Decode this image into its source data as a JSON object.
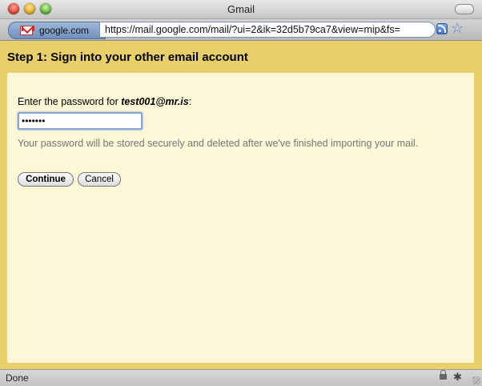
{
  "window": {
    "title": "Gmail"
  },
  "addressbar": {
    "site_label": "google.com",
    "url": "https://mail.google.com/mail/?ui=2&ik=32d5b79ca7&view=mip&fs=",
    "icons": [
      "gmail-icon",
      "rss-icon",
      "bookmark-star-icon"
    ]
  },
  "content": {
    "heading": "Step 1: Sign into your other email account",
    "password_label_prefix": "Enter the password for ",
    "account": "test001@mr.is",
    "password_label_suffix": ":",
    "password_value": "•••••••",
    "help_text": "Your password will be stored securely and deleted after we've finished importing your mail.",
    "continue_label": "Continue",
    "cancel_label": "Cancel"
  },
  "statusbar": {
    "text": "Done",
    "icons": [
      "lock-icon",
      "bug-icon"
    ]
  },
  "colors": {
    "frame": "#e8cf6a",
    "panel": "#fcf7d6",
    "help_text": "#777777"
  }
}
